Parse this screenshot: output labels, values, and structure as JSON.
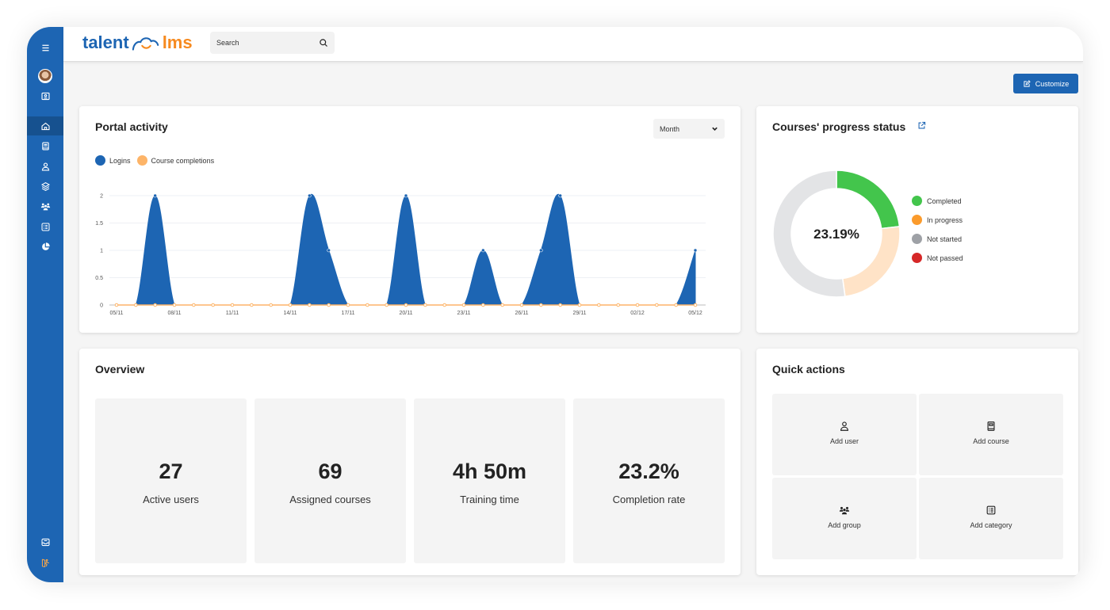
{
  "app": {
    "logo_left": "talent",
    "logo_right": "lms"
  },
  "search": {
    "placeholder": "Search",
    "value": ""
  },
  "sidebar": {
    "items": [
      {
        "name": "menu",
        "icon": "hamburger-icon"
      },
      {
        "name": "profile",
        "icon": "avatar"
      },
      {
        "name": "role",
        "icon": "id-badge-icon"
      },
      {
        "name": "home",
        "icon": "home-icon",
        "active": true
      },
      {
        "name": "courses",
        "icon": "book-icon"
      },
      {
        "name": "users",
        "icon": "user-icon"
      },
      {
        "name": "learning-paths",
        "icon": "layers-icon"
      },
      {
        "name": "groups",
        "icon": "group-icon"
      },
      {
        "name": "categories",
        "icon": "list-icon"
      },
      {
        "name": "reports",
        "icon": "pie-chart-icon"
      },
      {
        "name": "messages",
        "icon": "inbox-icon"
      },
      {
        "name": "logout",
        "icon": "exit-icon"
      }
    ]
  },
  "toolbar": {
    "customize_label": "Customize"
  },
  "portal": {
    "title": "Portal activity",
    "period": "Month",
    "legend": [
      {
        "label": "Logins",
        "color": "#1d65b3"
      },
      {
        "label": "Course completions",
        "color": "#fdb468"
      }
    ]
  },
  "chart_data": [
    {
      "type": "area",
      "title": "Portal activity",
      "x": [
        "05/11",
        "06/11",
        "07/11",
        "08/11",
        "09/11",
        "10/11",
        "11/11",
        "12/11",
        "13/11",
        "14/11",
        "15/11",
        "16/11",
        "17/11",
        "18/11",
        "19/11",
        "20/11",
        "21/11",
        "22/11",
        "23/11",
        "24/11",
        "25/11",
        "26/11",
        "27/11",
        "28/11",
        "29/11",
        "30/11",
        "01/12",
        "02/12",
        "03/12",
        "04/12",
        "05/12"
      ],
      "x_tick_labels": [
        "05/11",
        "08/11",
        "11/11",
        "14/11",
        "17/11",
        "20/11",
        "23/11",
        "26/11",
        "29/11",
        "02/12",
        "05/12"
      ],
      "series": [
        {
          "name": "Logins",
          "color": "#1d65b3",
          "values": [
            0,
            0,
            2,
            0,
            0,
            0,
            0,
            0,
            0,
            0,
            2,
            1,
            0,
            0,
            0,
            2,
            0,
            0,
            0,
            1,
            0,
            0,
            1,
            2,
            0,
            0,
            0,
            0,
            0,
            0,
            1
          ]
        },
        {
          "name": "Course completions",
          "color": "#fdb468",
          "values": [
            0,
            0,
            0,
            0,
            0,
            0,
            0,
            0,
            0,
            0,
            0,
            0,
            0,
            0,
            0,
            0,
            0,
            0,
            0,
            0,
            0,
            0,
            0,
            0,
            0,
            0,
            0,
            0,
            0,
            0,
            0
          ]
        }
      ],
      "ylim": [
        0,
        2
      ],
      "y_ticks": [
        "0",
        "0.5",
        "1",
        "1.5",
        "2"
      ],
      "grid": true,
      "legend": "top-left"
    },
    {
      "type": "pie",
      "title": "Courses' progress status",
      "center_label": "23.19%",
      "categories": [
        "Completed",
        "In progress",
        "Not started",
        "Not passed"
      ],
      "values": [
        23.19,
        24.64,
        52.17,
        0
      ],
      "colors": [
        "#43c54c",
        "#ffe3c7",
        "#e3e4e6",
        "#d62828"
      ],
      "legend_colors": [
        "#43c54c",
        "#fb9b2c",
        "#9ea1a6",
        "#d62828"
      ],
      "legend": "right"
    }
  ],
  "progress": {
    "title": "Courses' progress status",
    "center": "23.19%",
    "legend": [
      {
        "label": "Completed",
        "color": "#43c54c"
      },
      {
        "label": "In progress",
        "color": "#fb9b2c"
      },
      {
        "label": "Not started",
        "color": "#9ea1a6"
      },
      {
        "label": "Not passed",
        "color": "#d62828"
      }
    ]
  },
  "overview": {
    "title": "Overview",
    "stats": [
      {
        "value": "27",
        "label": "Active users"
      },
      {
        "value": "69",
        "label": "Assigned courses"
      },
      {
        "value": "4h 50m",
        "label": "Training time"
      },
      {
        "value": "23.2%",
        "label": "Completion rate"
      }
    ]
  },
  "quick": {
    "title": "Quick actions",
    "actions": [
      {
        "label": "Add user",
        "icon": "user-icon"
      },
      {
        "label": "Add course",
        "icon": "book-icon"
      },
      {
        "label": "Add group",
        "icon": "group-icon"
      },
      {
        "label": "Add category",
        "icon": "list-icon"
      }
    ]
  },
  "colors": {
    "brand": "#1d65b3",
    "accent": "#f68a1f"
  }
}
